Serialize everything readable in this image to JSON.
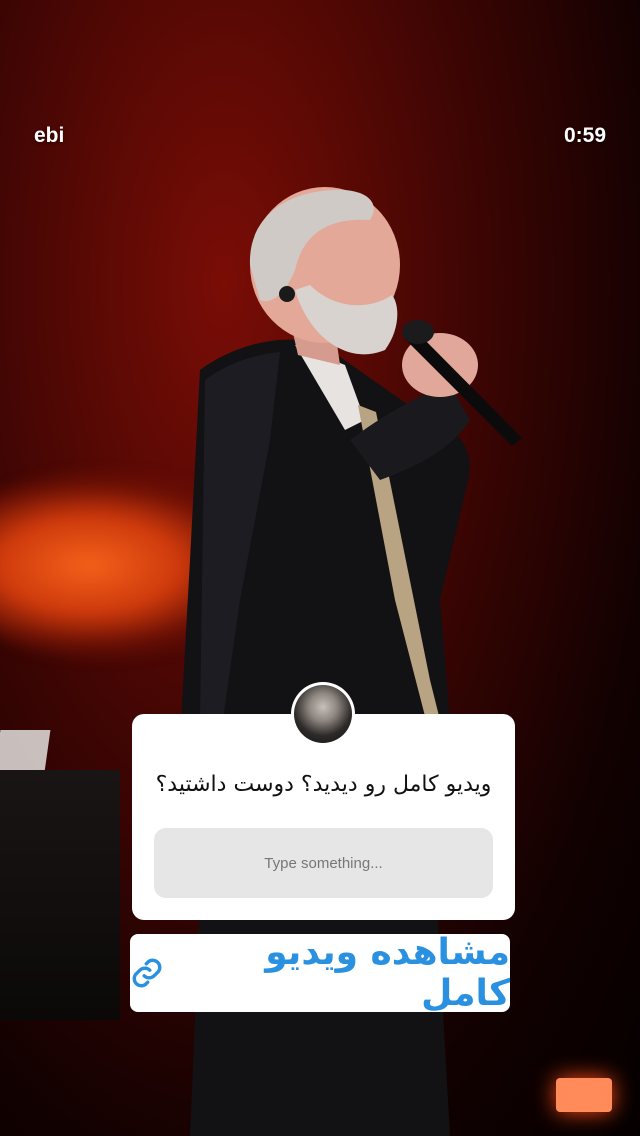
{
  "header": {
    "username": "ebi",
    "timer": "0:59"
  },
  "question": {
    "text": "ویدیو کامل رو دیدید؟ دوست داشتید؟",
    "placeholder": "Type something..."
  },
  "link_sticker": {
    "label": "مشاهده ویدیو کامل",
    "icon": "link-icon",
    "color": "#2a90e0"
  },
  "colors": {
    "stage_red": "#7a0d06",
    "glow_orange": "#f3611a"
  }
}
